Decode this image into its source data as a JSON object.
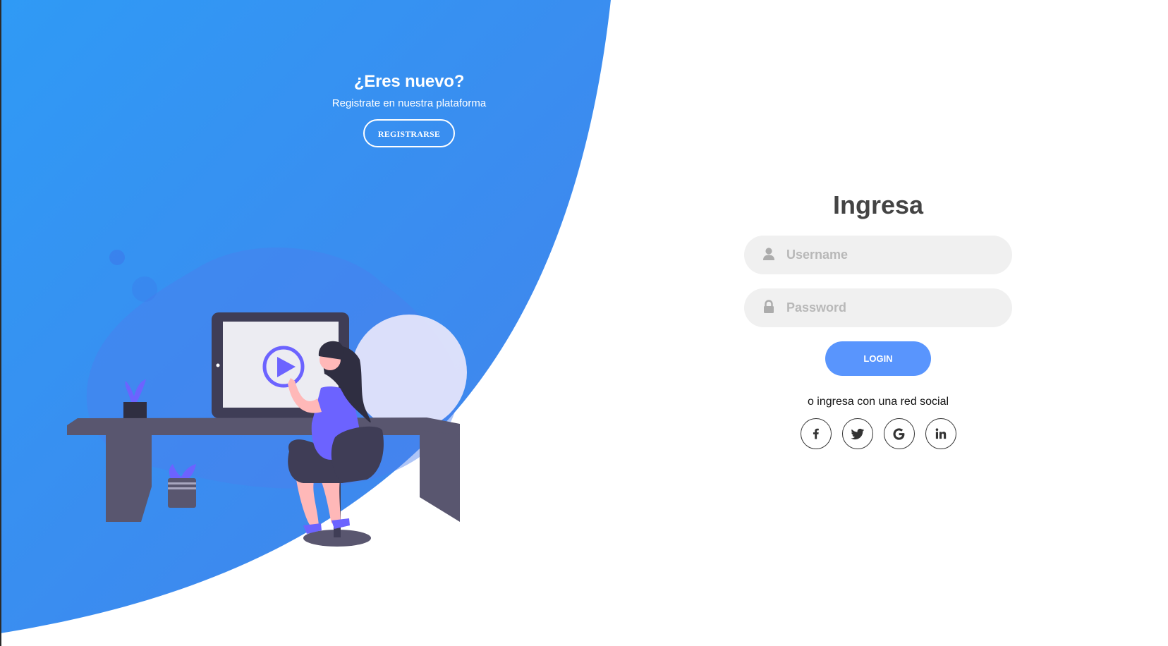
{
  "left_panel": {
    "title": "¿Eres nuevo?",
    "subtitle": "Registrate en nuestra plataforma",
    "register_label": "REGISTRARSE"
  },
  "login_form": {
    "title": "Ingresa",
    "username": {
      "placeholder": "Username",
      "value": "",
      "icon": "user-icon"
    },
    "password": {
      "placeholder": "Password",
      "value": "",
      "icon": "lock-icon"
    },
    "login_label": "LOGIN",
    "social_text": "o ingresa con una red social",
    "social_buttons": [
      {
        "name": "facebook",
        "icon": "facebook-icon"
      },
      {
        "name": "twitter",
        "icon": "twitter-icon"
      },
      {
        "name": "google",
        "icon": "google-icon"
      },
      {
        "name": "linkedin",
        "icon": "linkedin-icon"
      }
    ]
  },
  "colors": {
    "gradient_start": "#2f9af5",
    "gradient_end": "#4481eb",
    "login_button": "#5995fd",
    "input_bg": "#f0f0f0",
    "title": "#444444"
  }
}
